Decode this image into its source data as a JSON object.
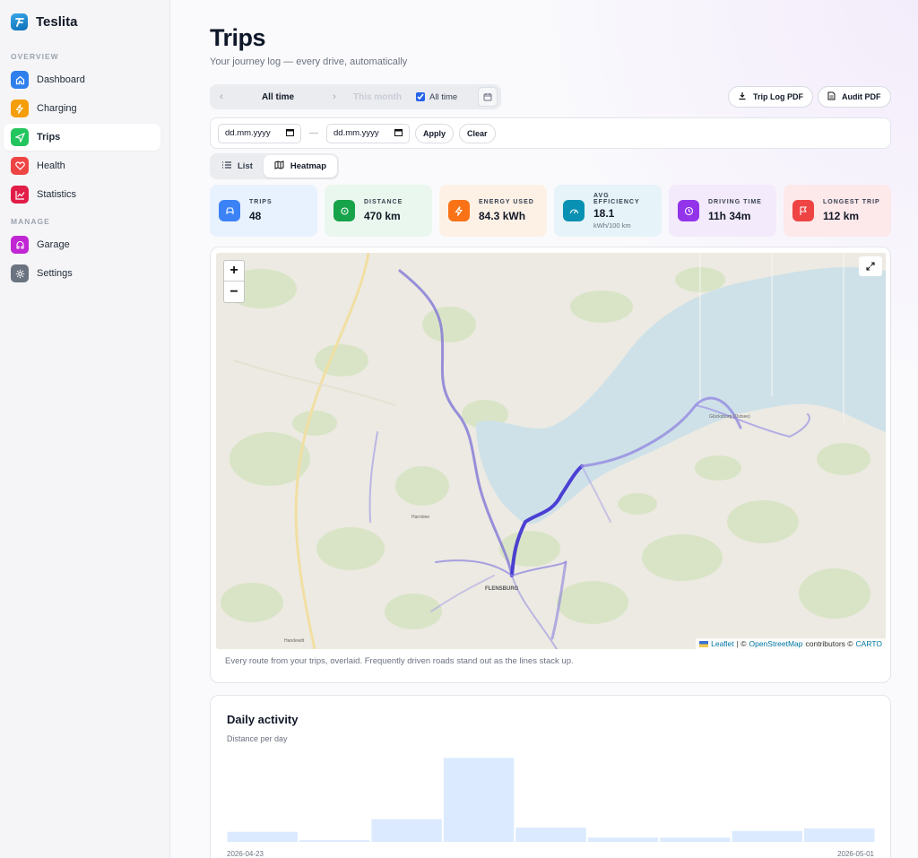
{
  "app": {
    "name": "Teslita"
  },
  "sidebar": {
    "overview_label": "OVERVIEW",
    "manage_label": "MANAGE",
    "overview_items": [
      {
        "label": "Dashboard",
        "icon": "home-icon",
        "color": "#2f80ed"
      },
      {
        "label": "Charging",
        "icon": "bolt-icon",
        "color": "#f59e0b"
      },
      {
        "label": "Trips",
        "icon": "navigation-icon",
        "color": "#22c55e",
        "active": true
      },
      {
        "label": "Health",
        "icon": "heart-icon",
        "color": "#ef4444"
      },
      {
        "label": "Statistics",
        "icon": "chart-icon",
        "color": "#e11d48"
      }
    ],
    "manage_items": [
      {
        "label": "Garage",
        "icon": "garage-icon",
        "color": "#c026d3"
      },
      {
        "label": "Settings",
        "icon": "gear-icon",
        "color": "#6b7280"
      }
    ]
  },
  "header": {
    "title": "Trips",
    "subtitle": "Your journey log — every drive, automatically"
  },
  "period": {
    "selected": "All time",
    "next": "This month",
    "all_time_checkbox": "All time",
    "all_time_checked": true
  },
  "actions": {
    "trip_log_pdf": "Trip Log PDF",
    "audit_pdf": "Audit PDF"
  },
  "filter": {
    "from_placeholder": "dd.mm.yyyy",
    "to_placeholder": "dd.mm.yyyy",
    "separator": "—",
    "apply": "Apply",
    "clear": "Clear"
  },
  "view": {
    "list": "List",
    "heatmap": "Heatmap",
    "selected": "Heatmap"
  },
  "stats": [
    {
      "label": "TRIPS",
      "value": "48",
      "icon": "car-icon",
      "icon_color": "#3b82f6",
      "bg": "#e8f1fe"
    },
    {
      "label": "DISTANCE",
      "value": "470 km",
      "icon": "route-icon",
      "icon_color": "#16a34a",
      "bg": "#eaf7ee"
    },
    {
      "label": "ENERGY USED",
      "value": "84.3 kWh",
      "icon": "bolt-icon",
      "icon_color": "#f97316",
      "bg": "#fdf1e6"
    },
    {
      "label": "AVG EFFICIENCY",
      "value": "18.1",
      "sub": "kWh/100 km",
      "icon": "gauge-icon",
      "icon_color": "#0891b2",
      "bg": "#e6f3f8"
    },
    {
      "label": "DRIVING TIME",
      "value": "11h 34m",
      "icon": "clock-icon",
      "icon_color": "#9333ea",
      "bg": "#f3eafb"
    },
    {
      "label": "LONGEST TRIP",
      "value": "112 km",
      "icon": "flag-icon",
      "icon_color": "#ef4444",
      "bg": "#fde8ea"
    }
  ],
  "map": {
    "zoom_in": "+",
    "zoom_out": "−",
    "labels": {
      "flensburg": "FLENSBURG",
      "harrislee": "Harrislee",
      "handewitt": "Handewitt",
      "glucksburg": "Glücksburg (Ostsee)"
    },
    "attribution": {
      "leaflet": "Leaflet",
      "sep": "| ©",
      "osm": "OpenStreetMap",
      "contributors": "contributors ©",
      "carto": "CARTO"
    },
    "caption": "Every route from your trips, overlaid. Frequently driven roads stand out as the lines stack up."
  },
  "activity": {
    "title": "Daily activity",
    "subtitle": "Distance per day"
  },
  "chart_data": {
    "type": "bar",
    "title": "Daily activity",
    "subtitle": "Distance per day",
    "categories": [
      "2026-04-23",
      "2026-04-24",
      "2026-04-25",
      "2026-04-26",
      "2026-04-27",
      "2026-04-28",
      "2026-04-29",
      "2026-04-30",
      "2026-05-01"
    ],
    "values": [
      12,
      2,
      27,
      100,
      17,
      5,
      5,
      13,
      16
    ],
    "x_tick_labels": [
      "2026-04-23",
      "2026-05-01"
    ],
    "ylim": [
      0,
      110
    ],
    "bar_color": "#dbeafe"
  }
}
